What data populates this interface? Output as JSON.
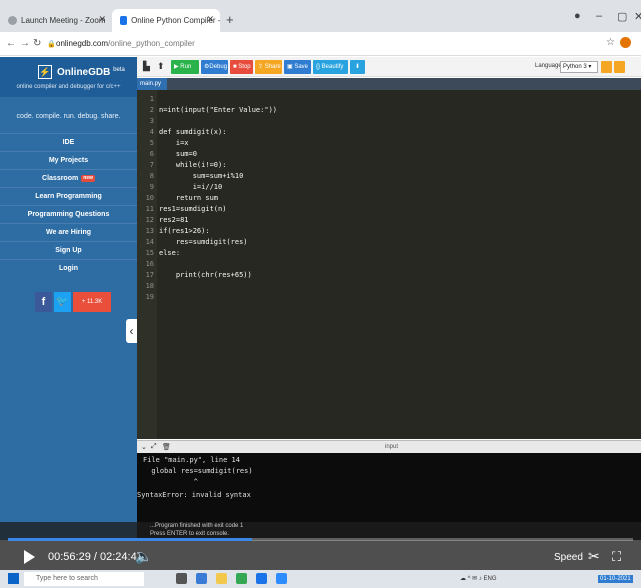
{
  "browser": {
    "tabs": [
      {
        "label": "Launch Meeting - Zoom"
      },
      {
        "label": "Online Python Compiler - online"
      }
    ],
    "new_tab": "+",
    "minimize": "–",
    "maximize": "▢",
    "close": "✕",
    "url_host": "onlinegdb.com",
    "url_path": "/online_python_compiler"
  },
  "sidebar": {
    "brand": "OnlineGDB",
    "brand_badge": "beta",
    "brand_sub": "online compiler and debugger for c/c++",
    "tagline": "code. compile. run. debug. share.",
    "items": [
      {
        "label": "IDE"
      },
      {
        "label": "My Projects"
      },
      {
        "label": "Classroom",
        "badge": "new"
      },
      {
        "label": "Learn Programming"
      },
      {
        "label": "Programming Questions"
      },
      {
        "label": "We are Hiring"
      },
      {
        "label": "Sign Up"
      },
      {
        "label": "Login"
      }
    ],
    "share_count": "11.3K"
  },
  "toolbar": {
    "run": "Run",
    "debug": "Debug",
    "stop": "Stop",
    "share": "Share",
    "save": "Save",
    "beautify": "{} Beautify",
    "language_label": "Language",
    "language_value": "Python 3"
  },
  "editor": {
    "file_tab": "main.py",
    "lines": [
      {
        "n": "1",
        "text": ""
      },
      {
        "n": "2",
        "text": "n=int(input(\"Enter Value:\"))"
      },
      {
        "n": "3",
        "text": ""
      },
      {
        "n": "4",
        "text": "def sumdigit(x):"
      },
      {
        "n": "5",
        "text": "    i=x"
      },
      {
        "n": "6",
        "text": "    sum=0"
      },
      {
        "n": "7",
        "text": "    while(i!=0):"
      },
      {
        "n": "8",
        "text": "        sum=sum+i%10"
      },
      {
        "n": "9",
        "text": "        i=i//10"
      },
      {
        "n": "10",
        "text": "    return sum"
      },
      {
        "n": "11",
        "text": "res1=sumdigit(n)"
      },
      {
        "n": "12",
        "text": "res2=81"
      },
      {
        "n": "13",
        "text": "if(res1>26):"
      },
      {
        "n": "14",
        "text": "    res=sumdigit(res)"
      },
      {
        "n": "15",
        "text": "else:"
      },
      {
        "n": "16",
        "text": ""
      },
      {
        "n": "17",
        "text": "    print(chr(res+65))"
      },
      {
        "n": "18",
        "text": ""
      },
      {
        "n": "19",
        "text": ""
      }
    ]
  },
  "terminal": {
    "title": "input",
    "lines": [
      "File \"main.py\", line 14",
      "  global res=sumdigit(res)",
      "            ^",
      "SyntaxError: invalid syntax"
    ]
  },
  "video": {
    "current_time": "00:56:29",
    "separator": " / ",
    "total_time": "02:24:47",
    "progress": 0.39,
    "speed_label": "Speed",
    "overlay_line1": "...Program finished with exit code 1",
    "overlay_line2": "Press ENTER to exit console."
  },
  "taskbar": {
    "search_placeholder": "Type here to search",
    "date": "01-10-2021"
  }
}
